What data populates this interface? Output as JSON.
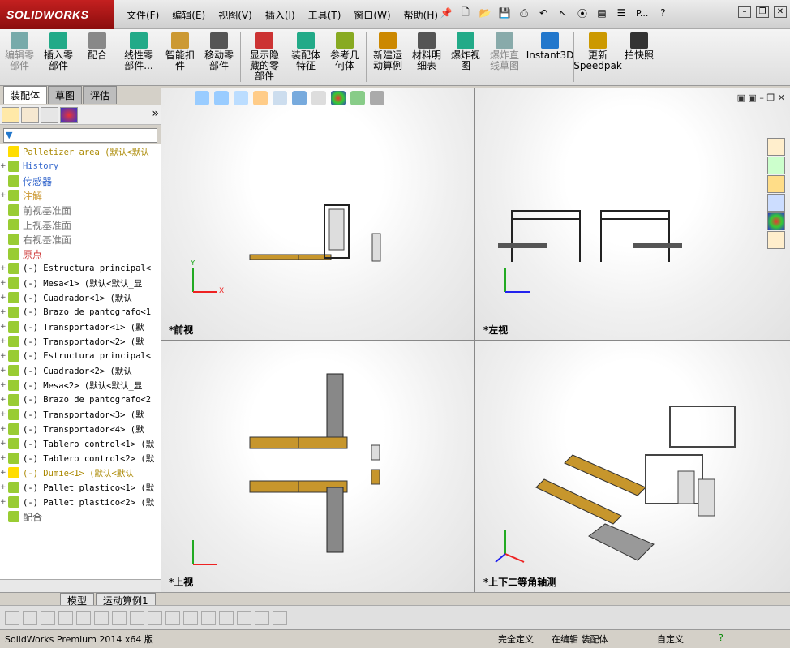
{
  "app": {
    "logo": "SOLIDWORKS"
  },
  "menu": [
    "文件(F)",
    "编辑(E)",
    "视图(V)",
    "插入(I)",
    "工具(T)",
    "窗口(W)",
    "帮助(H)"
  ],
  "titlebar": {
    "search_label": "P..."
  },
  "commands": [
    {
      "label": "编辑零部件",
      "disabled": true,
      "color": "#7aa"
    },
    {
      "label": "插入零部件",
      "disabled": false,
      "color": "#2a8"
    },
    {
      "label": "配合",
      "disabled": false,
      "color": "#888"
    },
    {
      "label": "线性零部件...",
      "disabled": false,
      "color": "#2a8"
    },
    {
      "label": "智能扣件",
      "disabled": false,
      "color": "#c93"
    },
    {
      "label": "移动零部件",
      "disabled": false,
      "color": "#555"
    },
    {
      "label": "显示隐藏的零部件",
      "disabled": false,
      "color": "#c33"
    },
    {
      "label": "装配体特征",
      "disabled": false,
      "color": "#2a8"
    },
    {
      "label": "参考几何体",
      "disabled": false,
      "color": "#8a2"
    },
    {
      "label": "新建运动算例",
      "disabled": false,
      "color": "#c80"
    },
    {
      "label": "材料明细表",
      "disabled": false,
      "color": "#555"
    },
    {
      "label": "爆炸视图",
      "disabled": false,
      "color": "#2a8"
    },
    {
      "label": "爆炸直线草图",
      "disabled": true,
      "color": "#8aa"
    },
    {
      "label": "Instant3D",
      "disabled": false,
      "color": "#27c"
    },
    {
      "label": "更新Speedpak",
      "disabled": false,
      "color": "#c90"
    },
    {
      "label": "拍快照",
      "disabled": false,
      "color": "#333"
    }
  ],
  "tabs": [
    "装配体",
    "草图",
    "评估"
  ],
  "tree": [
    {
      "exp": "",
      "label": "Palletizer area  (默认<默认",
      "warn": true,
      "color": "#a80"
    },
    {
      "exp": "+",
      "label": "History",
      "color": "#36c"
    },
    {
      "exp": "",
      "label": "传感器",
      "color": "#36c"
    },
    {
      "exp": "+",
      "label": "注解",
      "color": "#c93"
    },
    {
      "exp": "",
      "label": "前视基准面",
      "color": "#777"
    },
    {
      "exp": "",
      "label": "上视基准面",
      "color": "#777"
    },
    {
      "exp": "",
      "label": "右视基准面",
      "color": "#777"
    },
    {
      "exp": "",
      "label": "原点",
      "color": "#c33"
    },
    {
      "exp": "+",
      "label": "(-) Estructura principal<",
      "color": "#000"
    },
    {
      "exp": "+",
      "label": "(-) Mesa<1> (默认<默认_显",
      "color": "#000"
    },
    {
      "exp": "+",
      "label": "(-) Cuadrador<1> (默认",
      "color": "#000"
    },
    {
      "exp": "+",
      "label": "(-) Brazo de pantografo<1",
      "color": "#000"
    },
    {
      "exp": "+",
      "label": "(-) Transportador<1> (默",
      "color": "#000"
    },
    {
      "exp": "+",
      "label": "(-) Transportador<2> (默",
      "color": "#000"
    },
    {
      "exp": "+",
      "label": "(-) Estructura principal<",
      "color": "#000"
    },
    {
      "exp": "+",
      "label": "(-) Cuadrador<2> (默认",
      "color": "#000"
    },
    {
      "exp": "+",
      "label": "(-) Mesa<2> (默认<默认_显",
      "color": "#000"
    },
    {
      "exp": "+",
      "label": "(-) Brazo de pantografo<2",
      "color": "#000"
    },
    {
      "exp": "+",
      "label": "(-) Transportador<3> (默",
      "color": "#000"
    },
    {
      "exp": "+",
      "label": "(-) Transportador<4> (默",
      "color": "#000"
    },
    {
      "exp": "+",
      "label": "(-) Tablero control<1> (默",
      "color": "#000"
    },
    {
      "exp": "+",
      "label": "(-) Tablero control<2> (默",
      "color": "#000"
    },
    {
      "exp": "+",
      "label": "(-) Dumie<1> (默认<默认",
      "warn": true,
      "color": "#a80"
    },
    {
      "exp": "+",
      "label": "(-) Pallet plastico<1> (默",
      "color": "#000"
    },
    {
      "exp": "+",
      "label": "(-) Pallet plastico<2> (默",
      "color": "#000"
    },
    {
      "exp": "",
      "label": "配合",
      "color": "#555"
    }
  ],
  "views": {
    "front": "*前视",
    "left": "*左视",
    "top": "*上视",
    "iso": "*上下二等角轴测"
  },
  "axes": {
    "x": "X",
    "y": "Y",
    "z": "Z"
  },
  "bottomtabs": {
    "model": "模型",
    "motion": "运动算例1"
  },
  "status": {
    "version": "SolidWorks Premium 2014 x64 版",
    "defined": "完全定义",
    "editing": "在编辑 装配体",
    "custom": "自定义"
  }
}
